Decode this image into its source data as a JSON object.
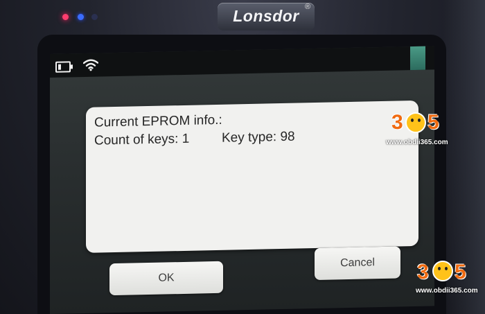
{
  "device": {
    "brand": "Lonsdor",
    "registered_mark": "®"
  },
  "status_bar": {
    "icons": [
      "battery-icon",
      "wifi-icon"
    ]
  },
  "dialog": {
    "title": "Current EPROM info.:",
    "count_of_keys": "Count of keys: 1",
    "key_type": "Key type: 98"
  },
  "buttons": {
    "ok_label": "OK",
    "cancel_label": "Cancel"
  },
  "watermark": {
    "digit_left": "3",
    "digit_right": "5",
    "url": "www.obdii365.com"
  },
  "colors": {
    "dialog_bg": "#f1f1ef",
    "screen_bg": "#2a2f30",
    "led_red": "#ff3d6e",
    "led_blue": "#3b6cff",
    "watermark_orange": "#f06a10"
  }
}
